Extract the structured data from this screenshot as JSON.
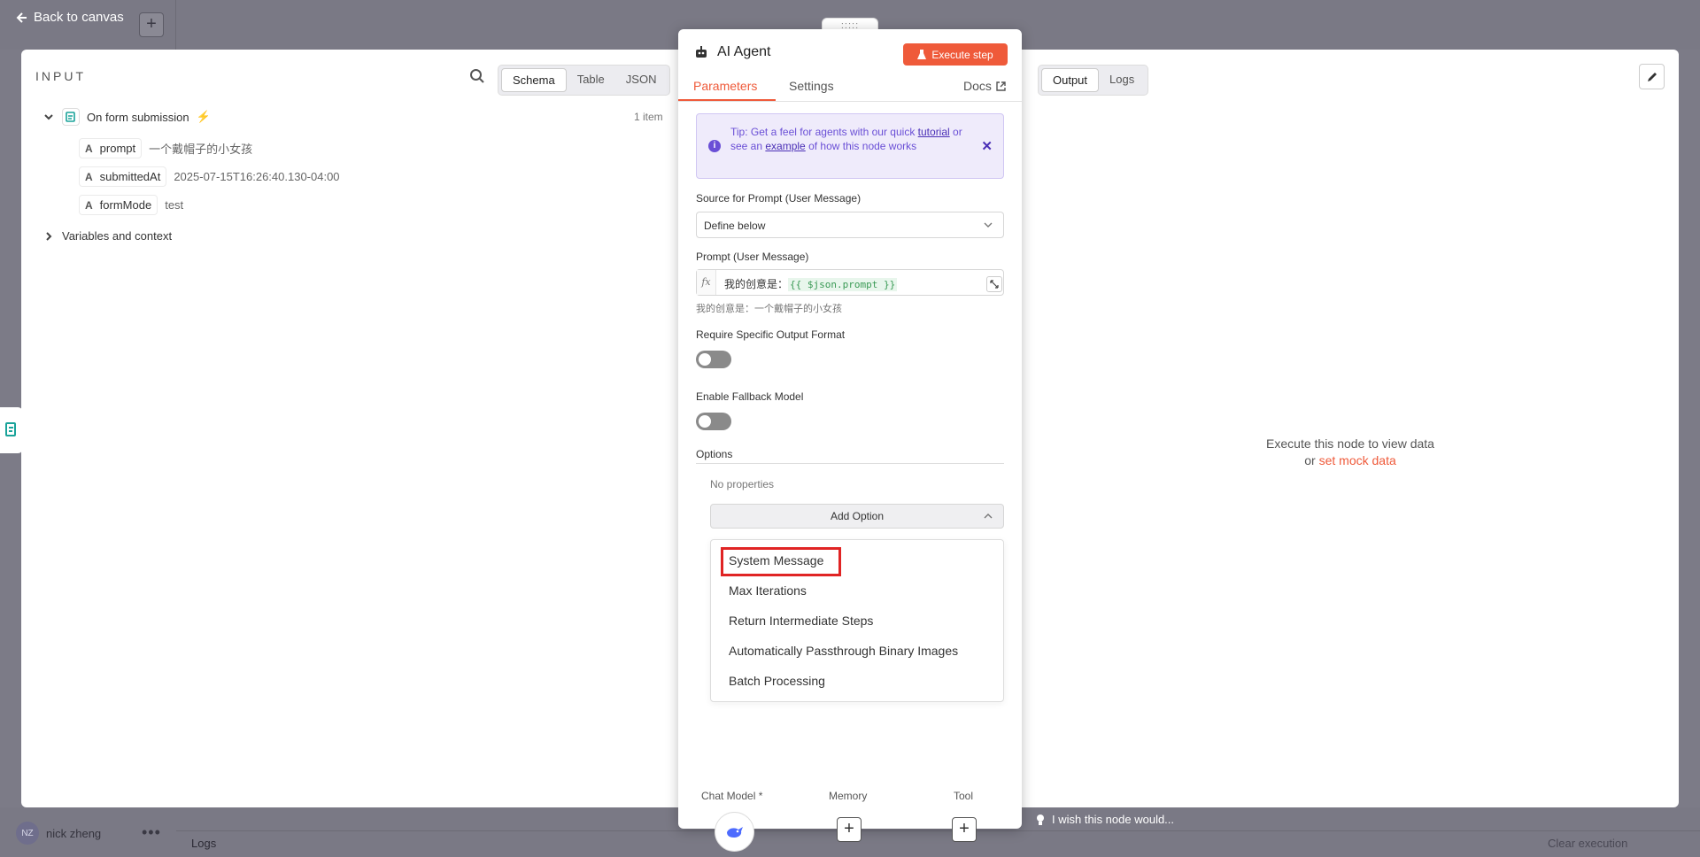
{
  "canvas": {
    "back_label": "Back to canvas",
    "user_initials": "NZ",
    "user_name": "nick zheng",
    "logs_label": "Logs",
    "clear_label": "Clear execution"
  },
  "input": {
    "title": "INPUT",
    "views": [
      "Schema",
      "Table",
      "JSON"
    ],
    "active_view": "Schema",
    "trigger_node": "On form submission",
    "item_count": "1 item",
    "fields": [
      {
        "type": "A",
        "name": "prompt",
        "value": "一个戴帽子的小女孩"
      },
      {
        "type": "A",
        "name": "submittedAt",
        "value": "2025-07-15T16:26:40.130-04:00"
      },
      {
        "type": "A",
        "name": "formMode",
        "value": "test"
      }
    ],
    "variables_label": "Variables and context"
  },
  "node": {
    "title": "AI Agent",
    "execute_label": "Execute step",
    "tabs": [
      "Parameters",
      "Settings"
    ],
    "docs_label": "Docs",
    "tip": {
      "prefix": "Tip: Get a feel for agents with our quick ",
      "link1": "tutorial",
      "middle": " or see an ",
      "link2": "example",
      "suffix": " of how this node works"
    },
    "source_label": "Source for Prompt (User Message)",
    "source_value": "Define below",
    "prompt_label": "Prompt (User Message)",
    "prompt_text": "我的创意是：",
    "prompt_expr": "{{ $json.prompt }}",
    "prompt_preview": "我的创意是：一个戴帽子的小女孩",
    "output_format_label": "Require Specific Output Format",
    "output_format_on": false,
    "fallback_label": "Enable Fallback Model",
    "fallback_on": false,
    "options_label": "Options",
    "no_properties": "No properties",
    "add_option_label": "Add Option",
    "option_items": [
      "System Message",
      "Max Iterations",
      "Return Intermediate Steps",
      "Automatically Passthrough Binary Images",
      "Batch Processing"
    ],
    "sub_nodes": {
      "chat_model": "Chat Model *",
      "memory": "Memory",
      "tool": "Tool"
    }
  },
  "output": {
    "views": [
      "Output",
      "Logs"
    ],
    "active_view": "Output",
    "empty_line1": "Execute this node to view data",
    "empty_or": "or ",
    "mock_link": "set mock data",
    "feedback": "I wish this node would..."
  },
  "colors": {
    "accent": "#ef5a3a",
    "tip_purple": "#6a4fd6",
    "highlight": "#e02424"
  }
}
